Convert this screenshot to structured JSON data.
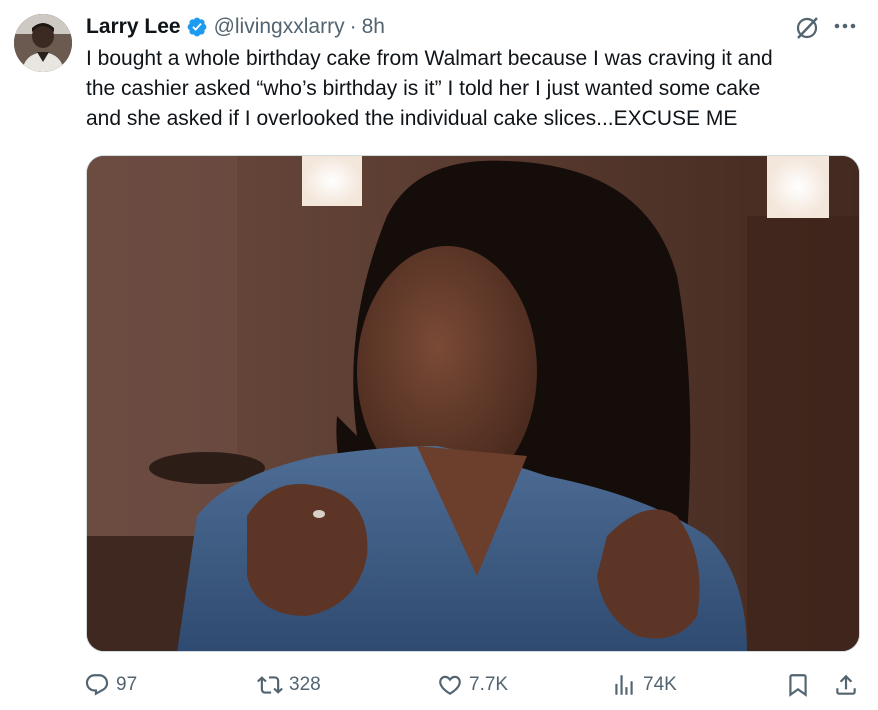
{
  "author": {
    "name": "Larry Lee",
    "handle": "@livingxxlarry",
    "separator": "·",
    "time": "8h",
    "verified": true
  },
  "tweet": {
    "lines": [
      "I bought a whole birthday cake from Walmart because I was craving it and",
      "the cashier asked “who’s birthday is it” I told her I just wanted some cake",
      "and she asked if I overlooked the individual cake slices...EXCUSE ME"
    ]
  },
  "actions": {
    "replies": "97",
    "retweets": "328",
    "likes": "7.7K",
    "views": "74K"
  },
  "icons": {
    "reply": "reply-icon",
    "retweet": "retweet-icon",
    "like": "heart-icon",
    "views": "views-icon",
    "bookmark": "bookmark-icon",
    "share": "share-icon",
    "grok": "grok-icon",
    "more": "more-icon",
    "verified": "verified-badge-icon"
  },
  "colors": {
    "text": "#0f1419",
    "secondary": "#536471",
    "verified": "#1d9bf0"
  }
}
